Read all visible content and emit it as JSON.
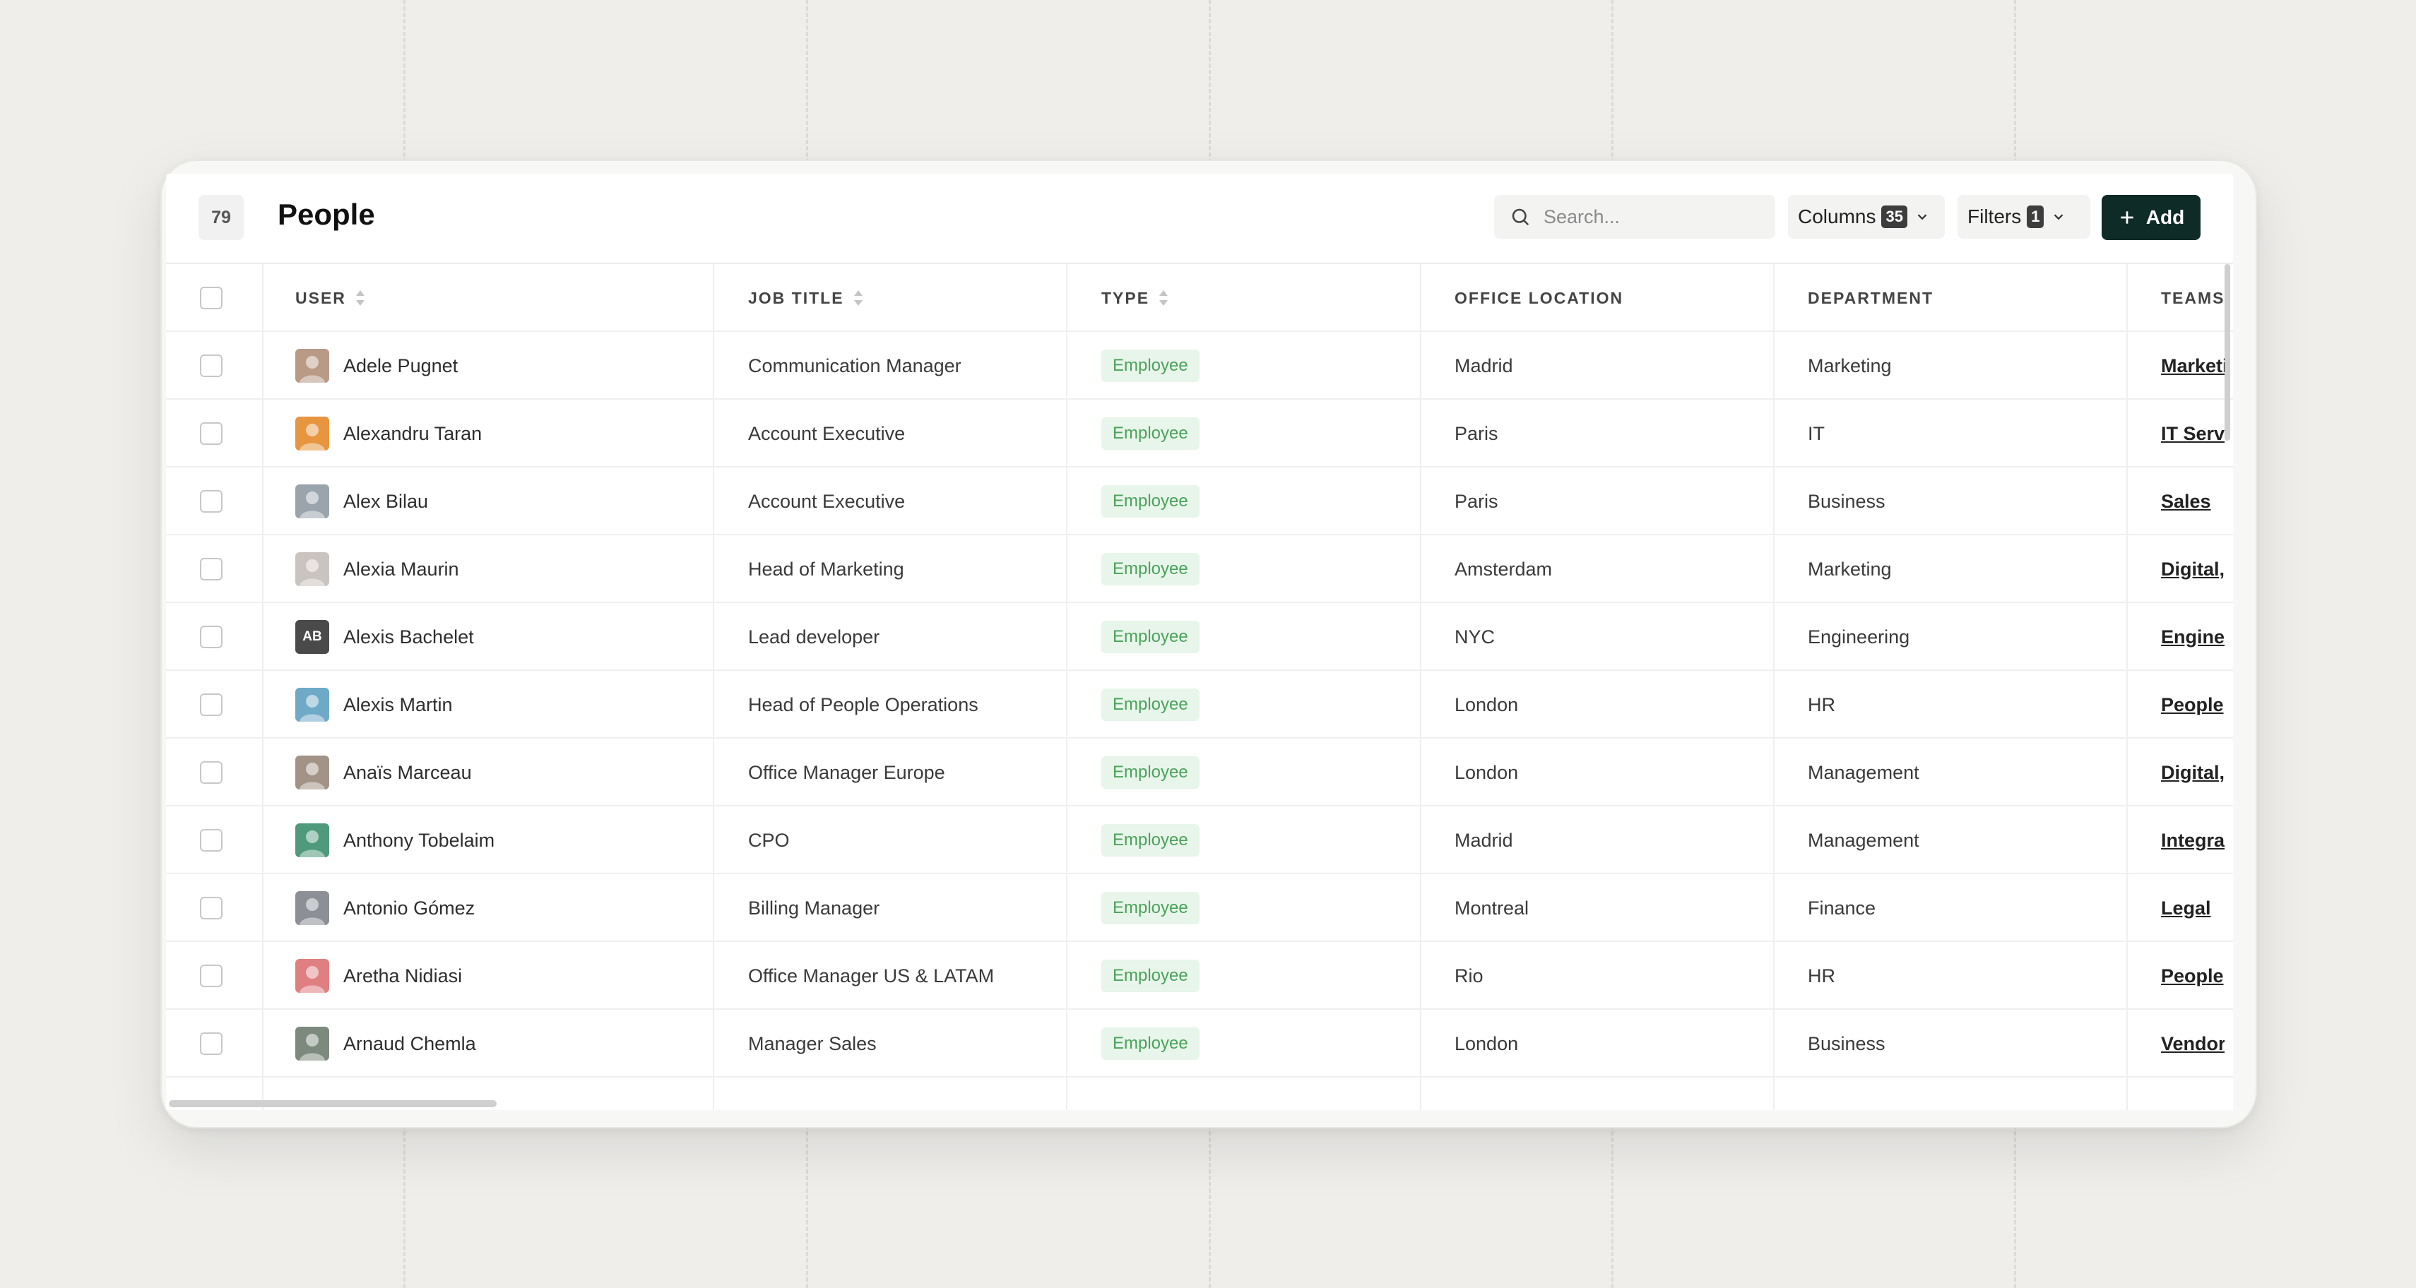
{
  "header": {
    "count": "79",
    "title": "People",
    "search_placeholder": "Search...",
    "columns_label": "Columns",
    "columns_count": "35",
    "filters_label": "Filters",
    "filters_count": "1",
    "add_label": "Add"
  },
  "columns": {
    "user": "USER",
    "job_title": "JOB TITLE",
    "type": "TYPE",
    "office_location": "OFFICE LOCATION",
    "department": "DEPARTMENT",
    "teams": "TEAMS"
  },
  "rows": [
    {
      "name": "Adele Pugnet",
      "job": "Communication Manager",
      "type": "Employee",
      "office": "Madrid",
      "dept": "Marketing",
      "team": "Marketi",
      "avatar_color": "#b89a86"
    },
    {
      "name": "Alexandru Taran",
      "job": "Account Executive",
      "type": "Employee",
      "office": "Paris",
      "dept": "IT",
      "team": "IT Servi",
      "avatar_color": "#e8953f"
    },
    {
      "name": "Alex Bilau",
      "job": "Account Executive",
      "type": "Employee",
      "office": "Paris",
      "dept": "Business",
      "team": "Sales",
      "avatar_color": "#9aa4ad"
    },
    {
      "name": "Alexia Maurin",
      "job": "Head of Marketing",
      "type": "Employee",
      "office": "Amsterdam",
      "dept": "Marketing",
      "team": "Digital,",
      "avatar_color": "#c9c4c0"
    },
    {
      "name": "Alexis Bachelet",
      "job": "Lead developer",
      "type": "Employee",
      "office": "NYC",
      "dept": "Engineering",
      "team": "Enginee",
      "avatar_color": "#4a4a4a",
      "initials": "AB"
    },
    {
      "name": "Alexis Martin",
      "job": "Head of People Operations",
      "type": "Employee",
      "office": "London",
      "dept": "HR",
      "team": "People",
      "avatar_color": "#6fa9c8"
    },
    {
      "name": "Anaïs Marceau",
      "job": "Office Manager Europe",
      "type": "Employee",
      "office": "London",
      "dept": "Management",
      "team": "Digital,",
      "avatar_color": "#a39387"
    },
    {
      "name": "Anthony Tobelaim",
      "job": "CPO",
      "type": "Employee",
      "office": "Madrid",
      "dept": "Management",
      "team": "Integra",
      "avatar_color": "#4f9a7c"
    },
    {
      "name": "Antonio Gómez",
      "job": "Billing Manager",
      "type": "Employee",
      "office": "Montreal",
      "dept": "Finance",
      "team": "Legal",
      "avatar_color": "#8c8f96"
    },
    {
      "name": "Aretha Nidiasi",
      "job": "Office Manager US & LATAM",
      "type": "Employee",
      "office": "Rio",
      "dept": "HR",
      "team": "People",
      "avatar_color": "#e07f82"
    },
    {
      "name": "Arnaud Chemla",
      "job": "Manager Sales",
      "type": "Employee",
      "office": "London",
      "dept": "Business",
      "team": "Vendor",
      "avatar_color": "#7c8a7d"
    }
  ]
}
